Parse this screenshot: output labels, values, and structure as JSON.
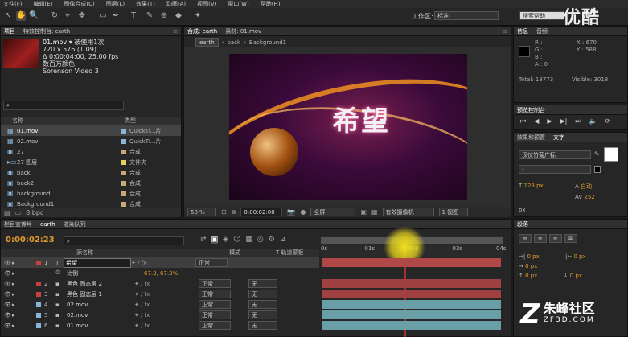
{
  "menu": [
    "文件(F)",
    "编辑(E)",
    "图像合成(C)",
    "图层(L)",
    "效果(T)",
    "动画(A)",
    "视图(V)",
    "窗口(W)",
    "帮助(H)"
  ],
  "toolbar": {
    "workspace_label": "工作区:",
    "workspace_value": "标准",
    "search_placeholder": "搜索帮助"
  },
  "watermark_top": "优酷",
  "project_panel": {
    "tabs": [
      "项目",
      "特效控制台: earth"
    ],
    "file_name": "01.mov",
    "usage": "▾ 被使用1次",
    "info_lines": [
      "720 x 576 (1.09)",
      "Δ 0:00:04:00, 25.00 fps",
      "数百万颜色",
      "Sorenson Video 3"
    ],
    "columns": [
      "名称",
      "类型"
    ],
    "items": [
      {
        "name": "01.mov",
        "type": "QuickTi...片",
        "color": "#8ab4d8",
        "icon": "film-icon",
        "selected": true
      },
      {
        "name": "02.mov",
        "type": "QuickTi...片",
        "color": "#8ab4d8",
        "icon": "film-icon"
      },
      {
        "name": "27",
        "type": "合成",
        "color": "#c8a878",
        "icon": "composition-icon"
      },
      {
        "name": "27 图层",
        "type": "文件夹",
        "color": "#e8d060",
        "icon": "folder-icon"
      },
      {
        "name": "back",
        "type": "合成",
        "color": "#c8a878",
        "icon": "composition-icon"
      },
      {
        "name": "back2",
        "type": "合成",
        "color": "#c8a878",
        "icon": "composition-icon"
      },
      {
        "name": "background",
        "type": "合成",
        "color": "#c8a878",
        "icon": "composition-icon"
      },
      {
        "name": "Background1",
        "type": "合成",
        "color": "#c8a878",
        "icon": "composition-icon"
      }
    ],
    "bpc": "8 bpc"
  },
  "comp_panel": {
    "tabs": [
      "合成: earth",
      "素材: 01.mov"
    ],
    "breadcrumbs": [
      "earth",
      "back",
      "Background1"
    ],
    "preview_text": "希望",
    "zoom": "50 %",
    "timecode": "0:00:02:00",
    "resolution": "全屏",
    "camera": "有效摄像机",
    "view": "1 视图"
  },
  "info_panel": {
    "tabs": [
      "信息",
      "音频"
    ],
    "rgba_labels": [
      "R :",
      "G :",
      "B :",
      "A : 0"
    ],
    "x": "X : 670",
    "y": "Y : 588",
    "total": "Total: 13773",
    "visible": "Visible: 3018"
  },
  "preview_panel": {
    "tab": "预览控制台"
  },
  "effects_panel": {
    "tabs": [
      "效果和预置",
      "文字"
    ],
    "font": "汉仪竹菊广标",
    "font_style": "-",
    "size": "128 px",
    "leading": "自动",
    "tracking": "252",
    "unit": "px"
  },
  "paragraph_panel": {
    "tab": "段落",
    "values": [
      "0 px",
      "0 px",
      "0 px",
      "0 px",
      "0 px"
    ]
  },
  "timeline": {
    "tabs": [
      "栏目宣传片",
      "earth",
      "渲染队列"
    ],
    "timecode": "0:00:02:23",
    "ruler": [
      "0s",
      "01s",
      "02s",
      "03s",
      "04s"
    ],
    "columns": [
      "源名称",
      "模式",
      "T 轨道蒙板"
    ],
    "layers": [
      {
        "num": "1",
        "name": "希望",
        "type": "T",
        "mode": "正常",
        "color": "#c84040",
        "bar": "#b04848",
        "selected": true
      },
      {
        "num": "",
        "name": "比例",
        "type": "",
        "mode": "",
        "color": "",
        "bar": "",
        "value": "67.3, 67.3%"
      },
      {
        "num": "2",
        "name": "黑色 固态层 2",
        "type": "",
        "mode": "正常",
        "track": "无",
        "color": "#c84040",
        "bar": "#a04040"
      },
      {
        "num": "3",
        "name": "黑色 固态层 1",
        "type": "",
        "mode": "正常",
        "track": "无",
        "color": "#c84040",
        "bar": "#a04040"
      },
      {
        "num": "4",
        "name": "02.mov",
        "type": "",
        "mode": "正常",
        "track": "无",
        "color": "#8ab4d8",
        "bar": "#6a9fa8"
      },
      {
        "num": "5",
        "name": "02.mov",
        "type": "",
        "mode": "正常",
        "track": "无",
        "color": "#8ab4d8",
        "bar": "#6a9fa8"
      },
      {
        "num": "6",
        "name": "01.mov",
        "type": "",
        "mode": "正常",
        "track": "无",
        "color": "#8ab4d8",
        "bar": "#6a9fa8"
      }
    ]
  },
  "watermark_bottom": {
    "name": "朱峰社区",
    "url": "ZF3D.COM"
  }
}
